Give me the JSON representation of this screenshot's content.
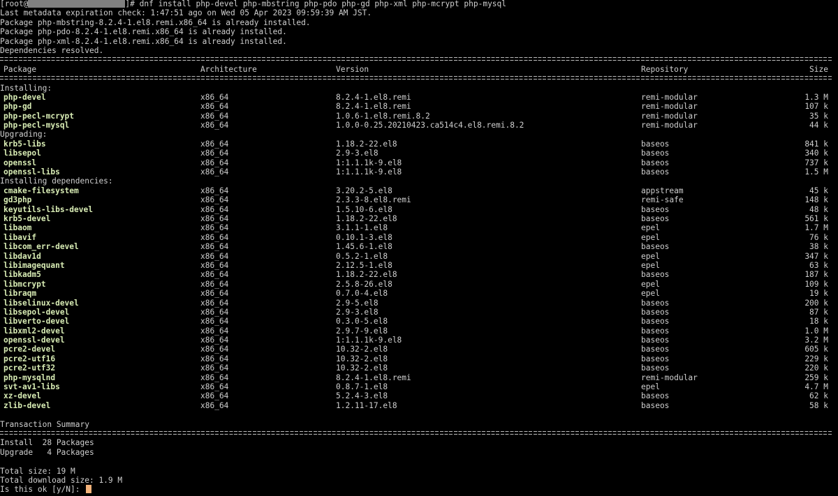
{
  "prompt": {
    "user": "[root@",
    "after_host": "]# ",
    "command": "dnf install php-devel php-mbstring php-pdo php-gd php-xml php-mcrypt php-mysql"
  },
  "preamble": [
    "Last metadata expiration check: 1:47:51 ago on Wed 05 Apr 2023 09:59:39 AM JST.",
    "Package php-mbstring-8.2.4-1.el8.remi.x86_64 is already installed.",
    "Package php-pdo-8.2.4-1.el8.remi.x86_64 is already installed.",
    "Package php-xml-8.2.4-1.el8.remi.x86_64 is already installed.",
    "Dependencies resolved."
  ],
  "columns": {
    "package": "Package",
    "arch": "Architecture",
    "version": "Version",
    "repo": "Repository",
    "size": "Size"
  },
  "sections": [
    {
      "label": "Installing:",
      "rows": [
        {
          "name": "php-devel",
          "arch": "x86_64",
          "version": "8.2.4-1.el8.remi",
          "repo": "remi-modular",
          "size": "1.3 M"
        },
        {
          "name": "php-gd",
          "arch": "x86_64",
          "version": "8.2.4-1.el8.remi",
          "repo": "remi-modular",
          "size": "107 k"
        },
        {
          "name": "php-pecl-mcrypt",
          "arch": "x86_64",
          "version": "1.0.6-1.el8.remi.8.2",
          "repo": "remi-modular",
          "size": "35 k"
        },
        {
          "name": "php-pecl-mysql",
          "arch": "x86_64",
          "version": "1.0.0-0.25.20210423.ca514c4.el8.remi.8.2",
          "repo": "remi-modular",
          "size": "44 k"
        }
      ]
    },
    {
      "label": "Upgrading:",
      "rows": [
        {
          "name": "krb5-libs",
          "arch": "x86_64",
          "version": "1.18.2-22.el8",
          "repo": "baseos",
          "size": "841 k"
        },
        {
          "name": "libsepol",
          "arch": "x86_64",
          "version": "2.9-3.el8",
          "repo": "baseos",
          "size": "340 k"
        },
        {
          "name": "openssl",
          "arch": "x86_64",
          "version": "1:1.1.1k-9.el8",
          "repo": "baseos",
          "size": "737 k"
        },
        {
          "name": "openssl-libs",
          "arch": "x86_64",
          "version": "1:1.1.1k-9.el8",
          "repo": "baseos",
          "size": "1.5 M"
        }
      ]
    },
    {
      "label": "Installing dependencies:",
      "rows": [
        {
          "name": "cmake-filesystem",
          "arch": "x86_64",
          "version": "3.20.2-5.el8",
          "repo": "appstream",
          "size": "45 k"
        },
        {
          "name": "gd3php",
          "arch": "x86_64",
          "version": "2.3.3-8.el8.remi",
          "repo": "remi-safe",
          "size": "148 k"
        },
        {
          "name": "keyutils-libs-devel",
          "arch": "x86_64",
          "version": "1.5.10-6.el8",
          "repo": "baseos",
          "size": "48 k"
        },
        {
          "name": "krb5-devel",
          "arch": "x86_64",
          "version": "1.18.2-22.el8",
          "repo": "baseos",
          "size": "561 k"
        },
        {
          "name": "libaom",
          "arch": "x86_64",
          "version": "3.1.1-1.el8",
          "repo": "epel",
          "size": "1.7 M"
        },
        {
          "name": "libavif",
          "arch": "x86_64",
          "version": "0.10.1-3.el8",
          "repo": "epel",
          "size": "76 k"
        },
        {
          "name": "libcom_err-devel",
          "arch": "x86_64",
          "version": "1.45.6-1.el8",
          "repo": "baseos",
          "size": "38 k"
        },
        {
          "name": "libdav1d",
          "arch": "x86_64",
          "version": "0.5.2-1.el8",
          "repo": "epel",
          "size": "347 k"
        },
        {
          "name": "libimagequant",
          "arch": "x86_64",
          "version": "2.12.5-1.el8",
          "repo": "epel",
          "size": "63 k"
        },
        {
          "name": "libkadm5",
          "arch": "x86_64",
          "version": "1.18.2-22.el8",
          "repo": "baseos",
          "size": "187 k"
        },
        {
          "name": "libmcrypt",
          "arch": "x86_64",
          "version": "2.5.8-26.el8",
          "repo": "epel",
          "size": "109 k"
        },
        {
          "name": "libraqm",
          "arch": "x86_64",
          "version": "0.7.0-4.el8",
          "repo": "epel",
          "size": "19 k"
        },
        {
          "name": "libselinux-devel",
          "arch": "x86_64",
          "version": "2.9-5.el8",
          "repo": "baseos",
          "size": "200 k"
        },
        {
          "name": "libsepol-devel",
          "arch": "x86_64",
          "version": "2.9-3.el8",
          "repo": "baseos",
          "size": "87 k"
        },
        {
          "name": "libverto-devel",
          "arch": "x86_64",
          "version": "0.3.0-5.el8",
          "repo": "baseos",
          "size": "18 k"
        },
        {
          "name": "libxml2-devel",
          "arch": "x86_64",
          "version": "2.9.7-9.el8",
          "repo": "baseos",
          "size": "1.0 M"
        },
        {
          "name": "openssl-devel",
          "arch": "x86_64",
          "version": "1:1.1.1k-9.el8",
          "repo": "baseos",
          "size": "3.2 M"
        },
        {
          "name": "pcre2-devel",
          "arch": "x86_64",
          "version": "10.32-2.el8",
          "repo": "baseos",
          "size": "605 k"
        },
        {
          "name": "pcre2-utf16",
          "arch": "x86_64",
          "version": "10.32-2.el8",
          "repo": "baseos",
          "size": "229 k"
        },
        {
          "name": "pcre2-utf32",
          "arch": "x86_64",
          "version": "10.32-2.el8",
          "repo": "baseos",
          "size": "220 k"
        },
        {
          "name": "php-mysqlnd",
          "arch": "x86_64",
          "version": "8.2.4-1.el8.remi",
          "repo": "remi-modular",
          "size": "259 k"
        },
        {
          "name": "svt-av1-libs",
          "arch": "x86_64",
          "version": "0.8.7-1.el8",
          "repo": "epel",
          "size": "4.7 M"
        },
        {
          "name": "xz-devel",
          "arch": "x86_64",
          "version": "5.2.4-3.el8",
          "repo": "baseos",
          "size": "62 k"
        },
        {
          "name": "zlib-devel",
          "arch": "x86_64",
          "version": "1.2.11-17.el8",
          "repo": "baseos",
          "size": "58 k"
        }
      ]
    }
  ],
  "summary": {
    "title": "Transaction Summary",
    "install": "Install  28 Packages",
    "upgrade": "Upgrade   4 Packages",
    "total_size": "Total size: 19 M",
    "download_size": "Total download size: 1.9 M",
    "question": "Is this ok [y/N]: "
  },
  "colors": {
    "background": "#000000",
    "text": "#cfcfcf",
    "package_name": "#d8ecb4",
    "cursor": "#f2b27a",
    "redaction": "#808080"
  }
}
